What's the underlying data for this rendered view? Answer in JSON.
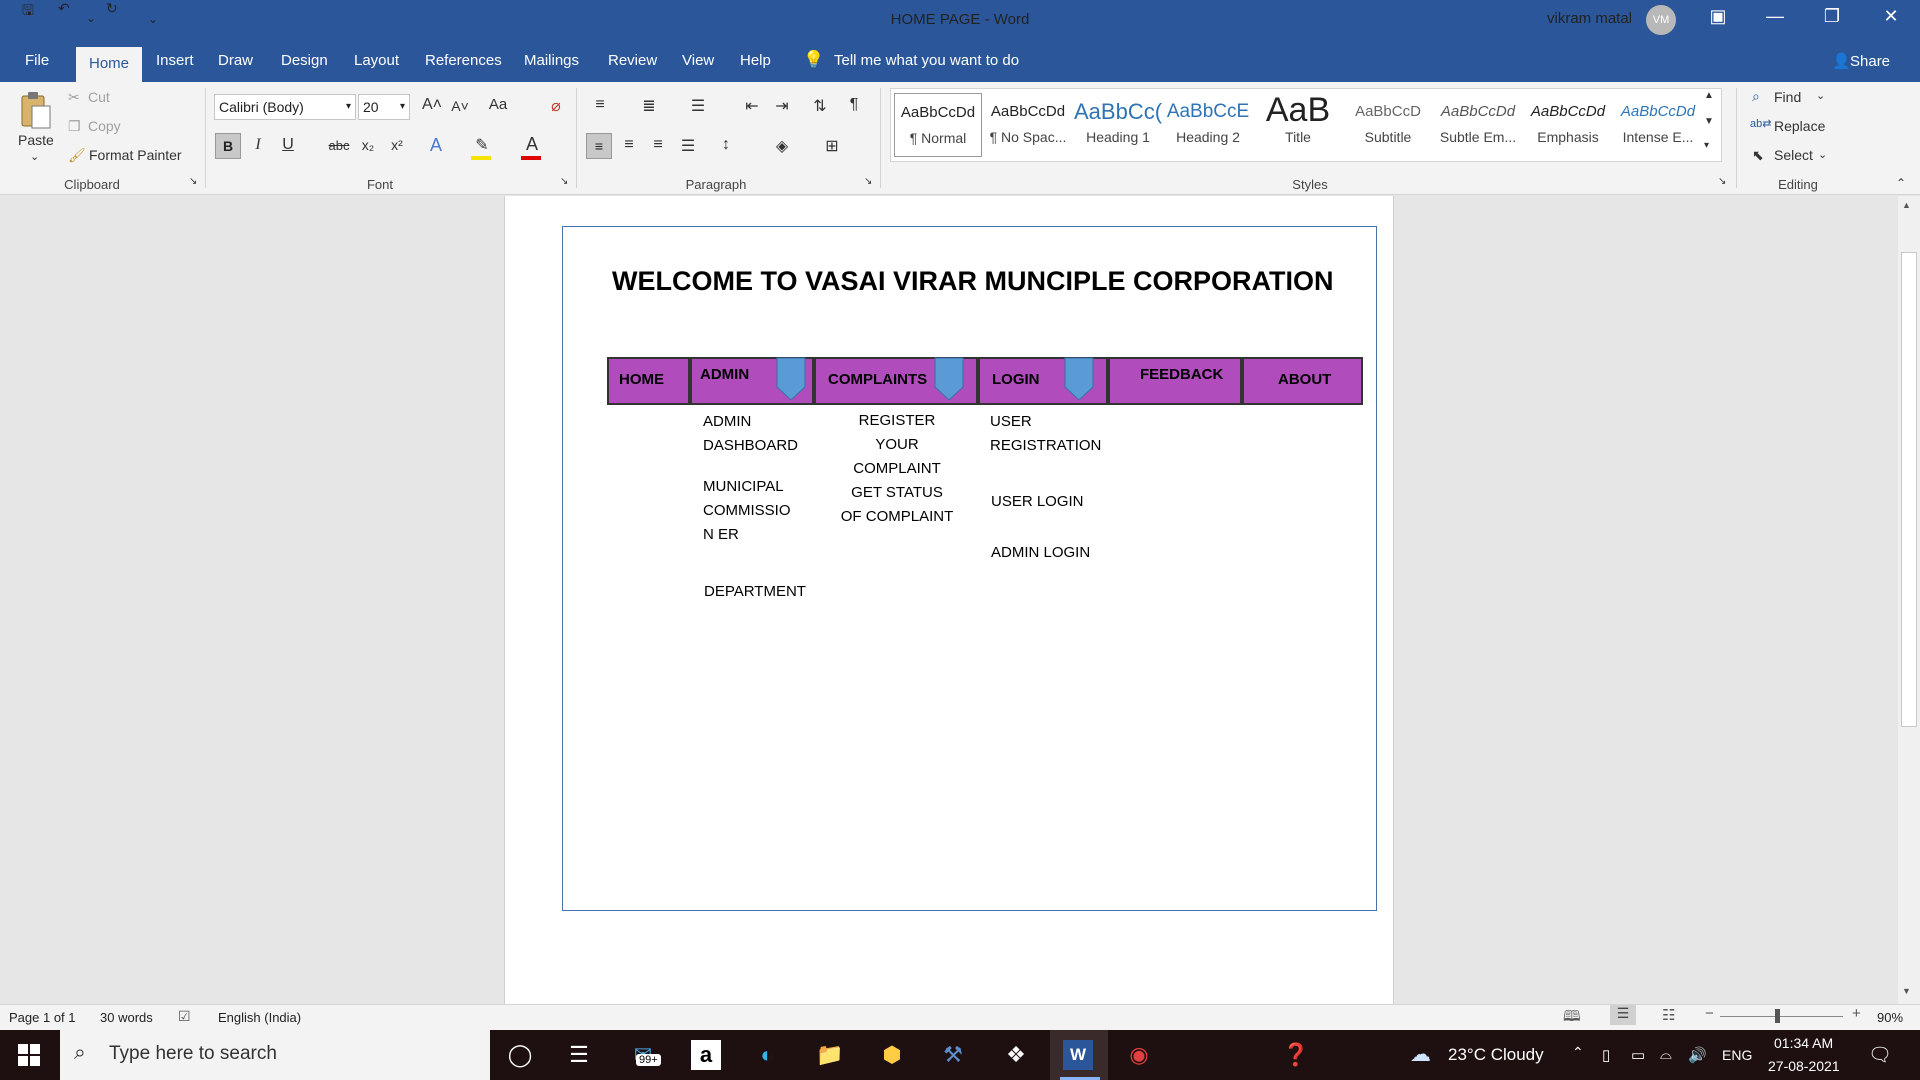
{
  "window": {
    "doc_title": "HOME PAGE  -  Word",
    "user_name": "vikram matal",
    "user_initials": "VM"
  },
  "menu": {
    "tabs": [
      "File",
      "Home",
      "Insert",
      "Draw",
      "Design",
      "Layout",
      "References",
      "Mailings",
      "Review",
      "View",
      "Help"
    ],
    "tell_me": "Tell me what you want to do",
    "share": "Share"
  },
  "ribbon": {
    "clipboard": {
      "label": "Clipboard",
      "paste": "Paste",
      "cut": "Cut",
      "copy": "Copy",
      "format_painter": "Format Painter"
    },
    "font": {
      "label": "Font",
      "font_name": "Calibri (Body)",
      "font_size": "20"
    },
    "paragraph": {
      "label": "Paragraph"
    },
    "styles": {
      "label": "Styles",
      "items": [
        {
          "sample": "AaBbCcDd",
          "name": "¶ Normal"
        },
        {
          "sample": "AaBbCcDd",
          "name": "¶ No Spac..."
        },
        {
          "sample": "AaBbCc(",
          "name": "Heading 1"
        },
        {
          "sample": "AaBbCcE",
          "name": "Heading 2"
        },
        {
          "sample": "AaB",
          "name": "Title"
        },
        {
          "sample": "AaBbCcD",
          "name": "Subtitle"
        },
        {
          "sample": "AaBbCcDd",
          "name": "Subtle Em..."
        },
        {
          "sample": "AaBbCcDd",
          "name": "Emphasis"
        },
        {
          "sample": "AaBbCcDd",
          "name": "Intense E..."
        }
      ]
    },
    "editing": {
      "label": "Editing",
      "find": "Find",
      "replace": "Replace",
      "select": "Select"
    }
  },
  "document": {
    "heading": "WELCOME TO VASAI VIRAR MUNCIPLE CORPORATION",
    "nav": [
      "HOME",
      "ADMIN",
      "COMPLAINTS",
      "LOGIN",
      "FEEDBACK",
      "ABOUT"
    ],
    "admin_items": [
      "ADMIN DASHBOARD",
      "MUNICIPAL COMMISSION ER",
      "DEPARTMENT"
    ],
    "complaint_items": [
      "REGISTER YOUR COMPLAINT",
      "GET STATUS OF COMPLAINT"
    ],
    "login_items": [
      "USER REGISTRATION",
      "USER LOGIN",
      "ADMIN LOGIN"
    ]
  },
  "status": {
    "page": "Page 1 of 1",
    "words": "30 words",
    "language": "English (India)",
    "zoom": "90%"
  },
  "taskbar": {
    "search_placeholder": "Type here to search",
    "mail_badge": "99+",
    "weather": "23°C  Cloudy",
    "lang": "ENG",
    "time": "01:34 AM",
    "date": "27-08-2021"
  },
  "colors": {
    "word_blue": "#2b579a",
    "nav_purple": "#b04cbc",
    "dropdown_blue": "#5b9bd5"
  }
}
